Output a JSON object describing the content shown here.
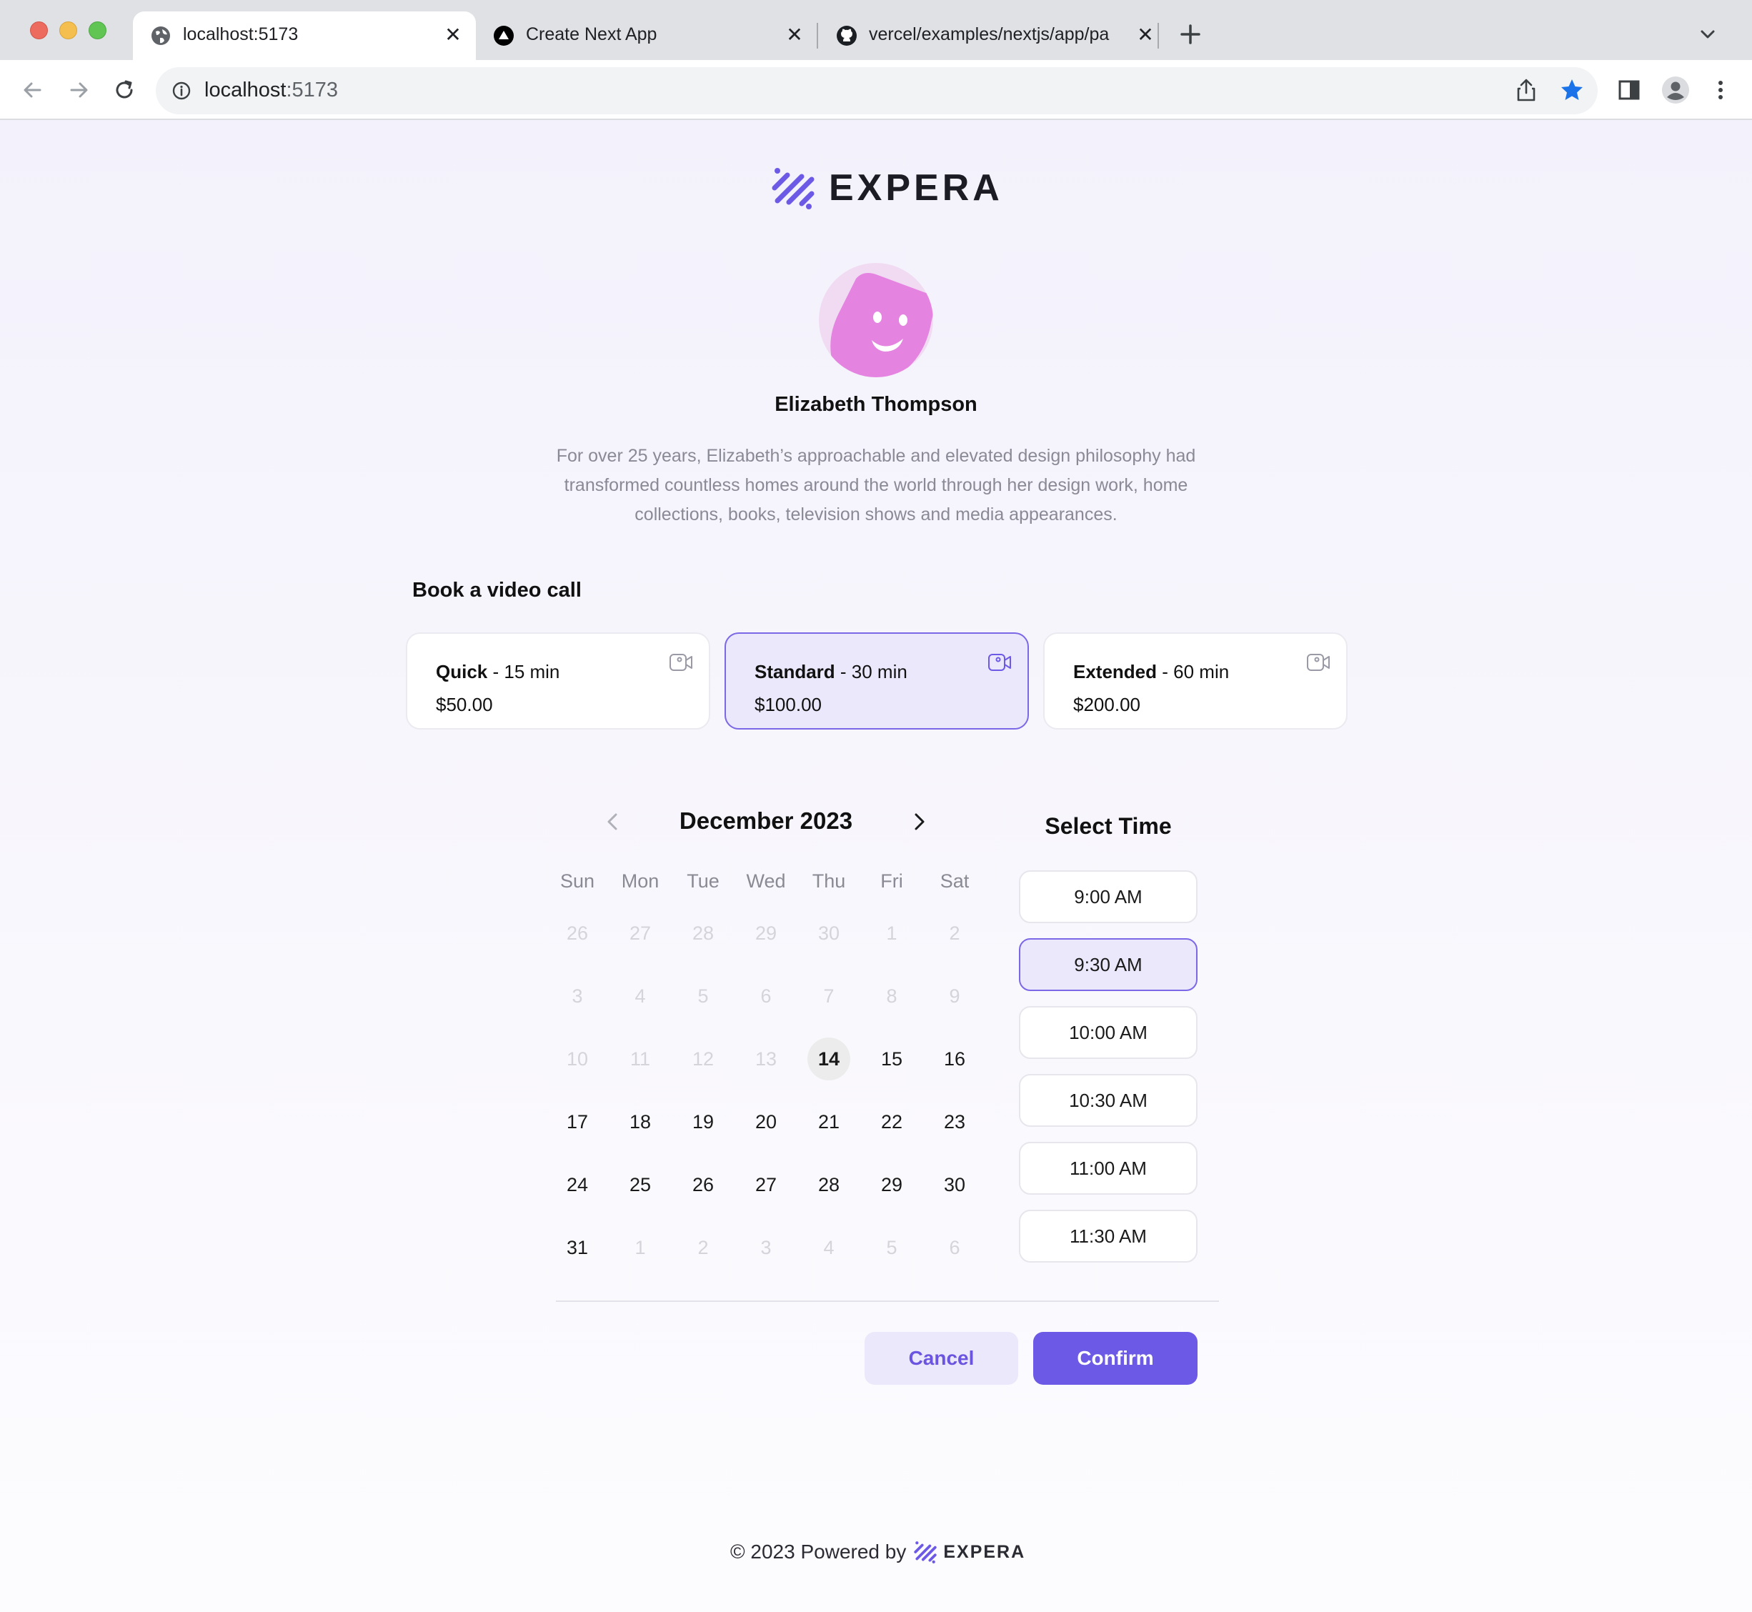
{
  "browser": {
    "tabs": [
      {
        "title": "localhost:5173",
        "active": true
      },
      {
        "title": "Create Next App",
        "active": false
      },
      {
        "title": "vercel/examples/nextjs/app/pa",
        "active": false
      }
    ],
    "url_host": "localhost",
    "url_port": ":5173"
  },
  "brand": {
    "name": "EXPERA",
    "accent": "#6c5ae6"
  },
  "host": {
    "name": "Elizabeth Thompson",
    "bio": "For over 25 years, Elizabeth’s approachable and elevated design philosophy had transformed countless homes around the world through her design work, home collections, books, television shows and media appearances."
  },
  "booking": {
    "title": "Book a video call",
    "plans": [
      {
        "name": "Quick",
        "duration": " - 15 min",
        "price": "$50.00",
        "selected": false
      },
      {
        "name": "Standard",
        "duration": " - 30 min",
        "price": "$100.00",
        "selected": true
      },
      {
        "name": "Extended",
        "duration": " - 60 min",
        "price": "$200.00",
        "selected": false
      }
    ]
  },
  "calendar": {
    "month_label": "December 2023",
    "weekdays": [
      "Sun",
      "Mon",
      "Tue",
      "Wed",
      "Thu",
      "Fri",
      "Sat"
    ],
    "weeks": [
      [
        "26",
        "27",
        "28",
        "29",
        "30",
        "1",
        "2"
      ],
      [
        "3",
        "4",
        "5",
        "6",
        "7",
        "8",
        "9"
      ],
      [
        "10",
        "11",
        "12",
        "13",
        "14",
        "15",
        "16"
      ],
      [
        "17",
        "18",
        "19",
        "20",
        "21",
        "22",
        "23"
      ],
      [
        "24",
        "25",
        "26",
        "27",
        "28",
        "29",
        "30"
      ],
      [
        "31",
        "1",
        "2",
        "3",
        "4",
        "5",
        "6"
      ]
    ],
    "today": "14",
    "first_available": "14"
  },
  "times": {
    "title": "Select Time",
    "slots": [
      "9:00 AM",
      "9:30 AM",
      "10:00 AM",
      "10:30 AM",
      "11:00 AM",
      "11:30 AM"
    ],
    "selected": "9:30 AM"
  },
  "actions": {
    "cancel": "Cancel",
    "confirm": "Confirm"
  },
  "footer": {
    "text": "© 2023 Powered by",
    "brand": "EXPERA"
  }
}
